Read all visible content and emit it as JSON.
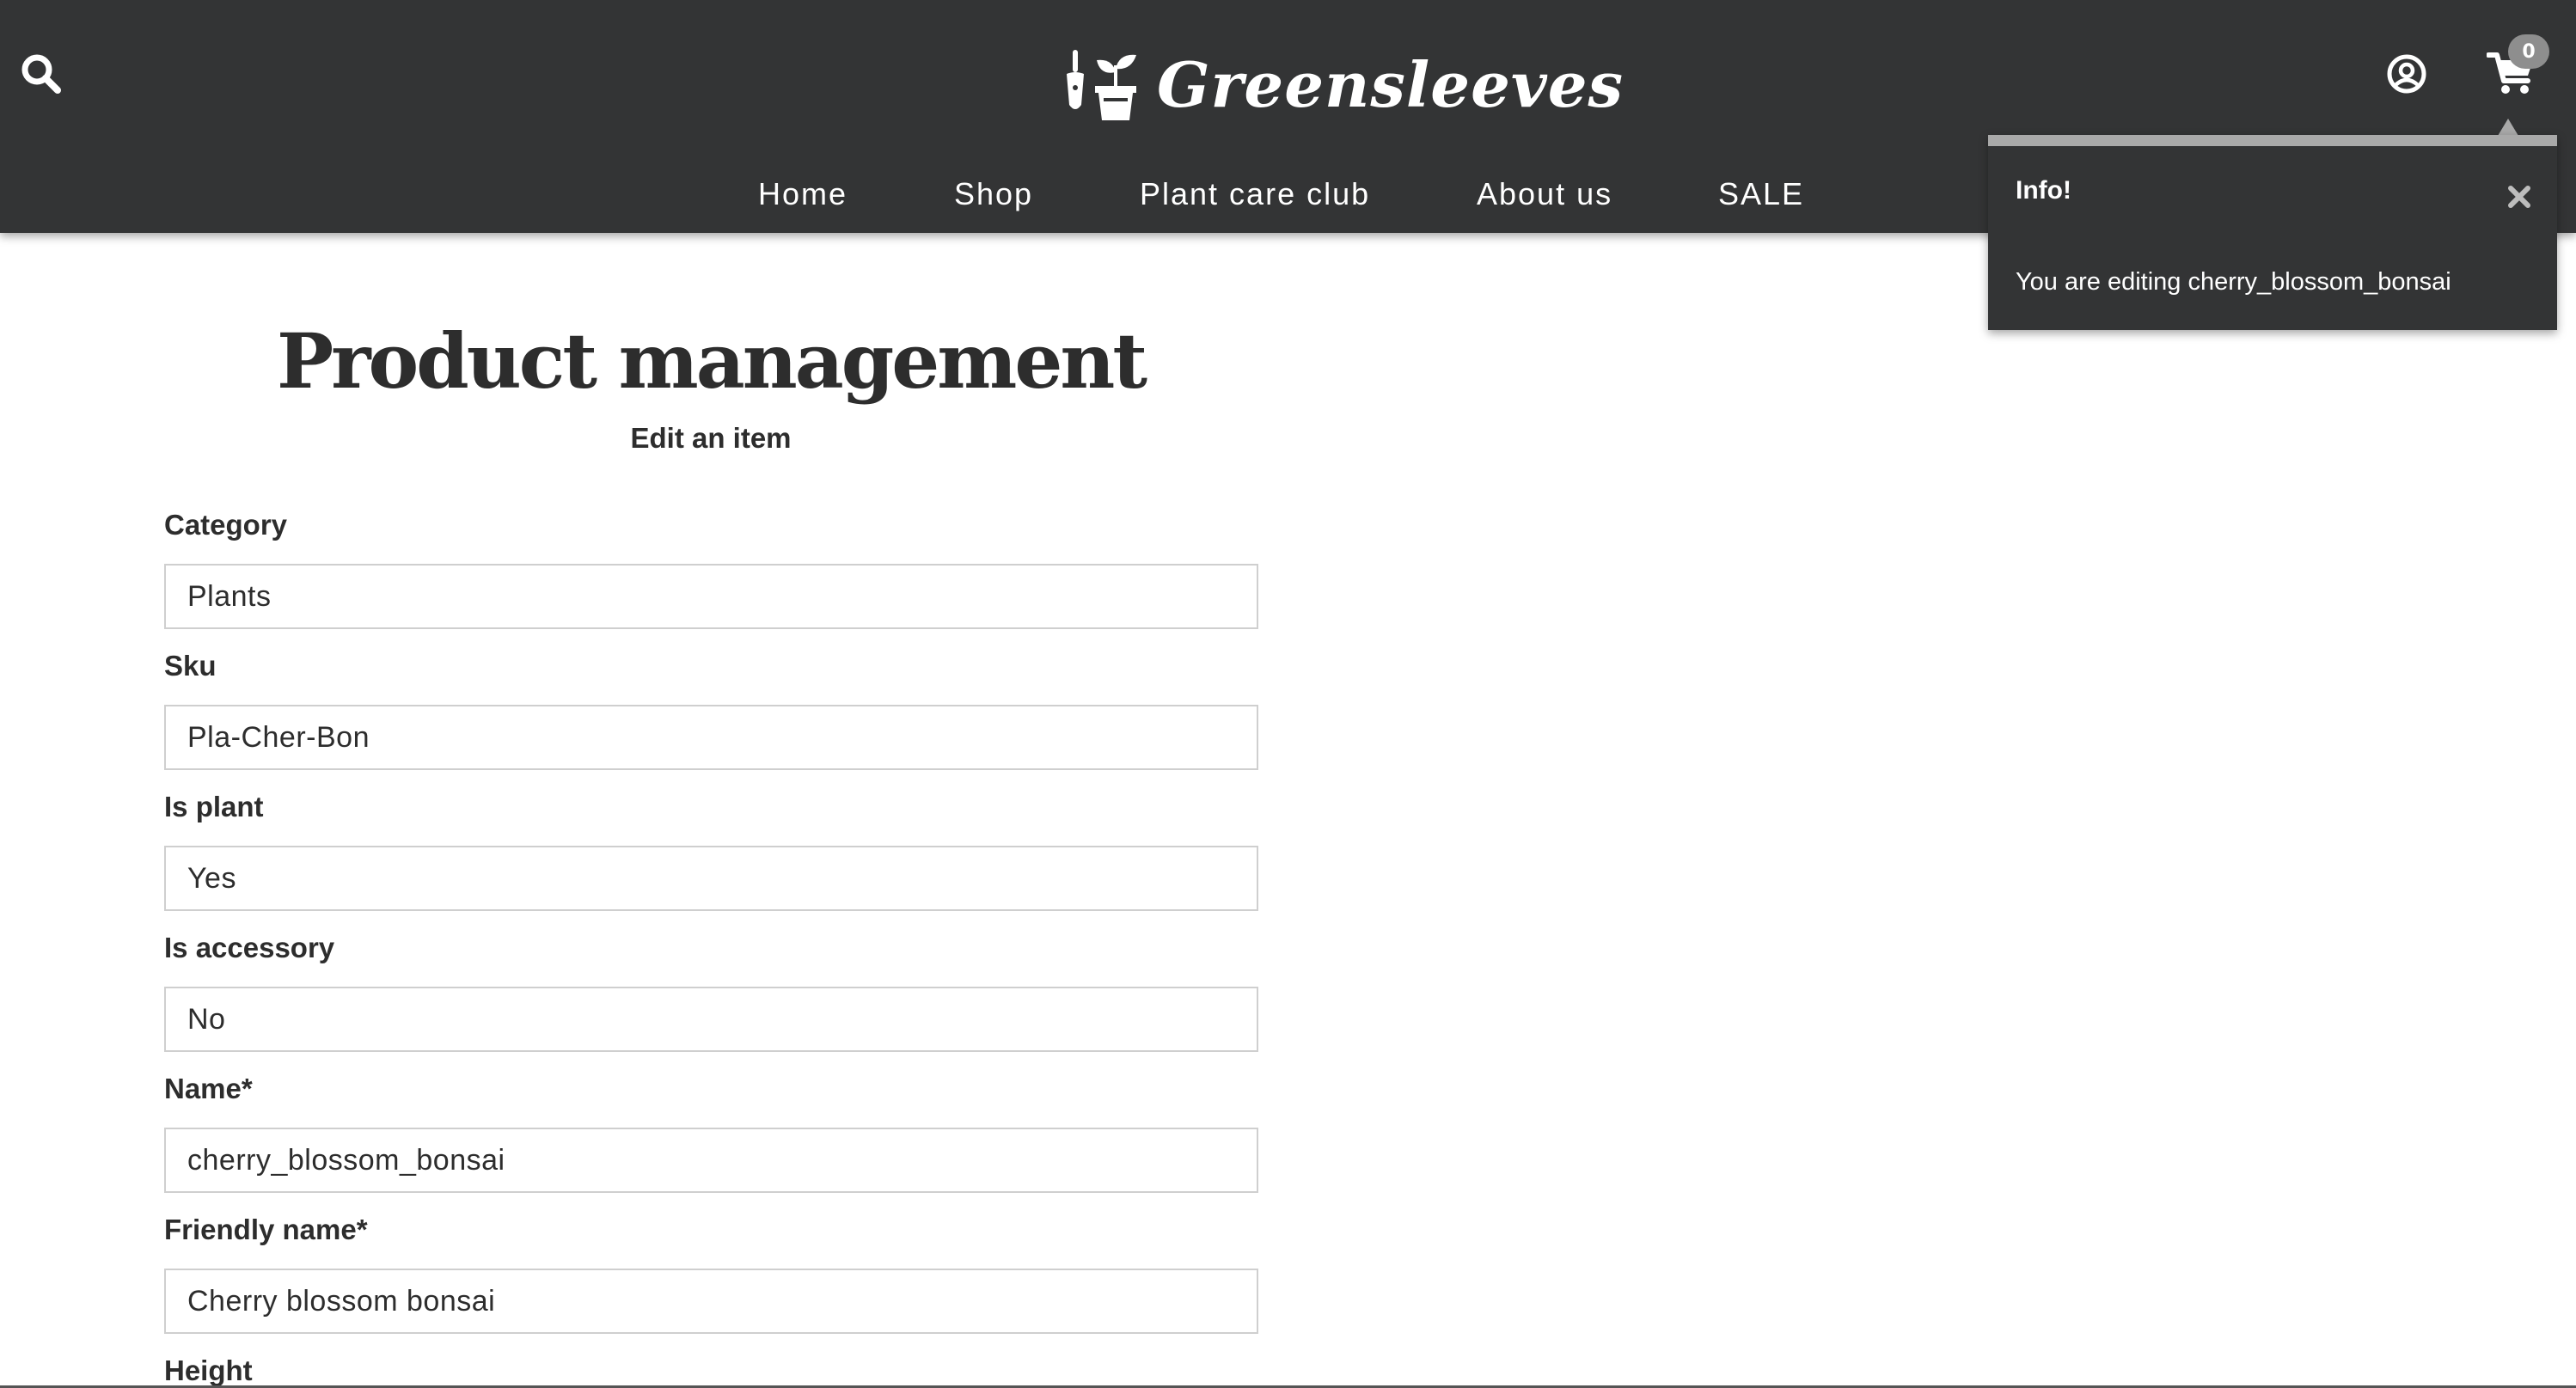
{
  "header": {
    "brand": "Greensleeves",
    "nav": [
      "Home",
      "Shop",
      "Plant care club",
      "About us",
      "SALE"
    ],
    "cart_count": "0",
    "colors": {
      "background": "#333435",
      "text": "#ffffff",
      "badge": "#8e8e8e"
    },
    "icons": [
      "search-icon",
      "plant-pot-logo-icon",
      "user-circle-icon",
      "cart-icon"
    ]
  },
  "toast": {
    "title": "Info!",
    "message": "You are editing cherry_blossom_bonsai",
    "icons": [
      "close-icon"
    ]
  },
  "main": {
    "title": "Product management",
    "subtitle": "Edit an item",
    "fields": [
      {
        "label": "Category",
        "value": "Plants"
      },
      {
        "label": "Sku",
        "value": "Pla-Cher-Bon"
      },
      {
        "label": "Is plant",
        "value": "Yes"
      },
      {
        "label": "Is accessory",
        "value": "No"
      },
      {
        "label": "Name*",
        "value": "cherry_blossom_bonsai"
      },
      {
        "label": "Friendly name*",
        "value": "Cherry blossom bonsai"
      },
      {
        "label": "Height",
        "value": ""
      }
    ]
  }
}
